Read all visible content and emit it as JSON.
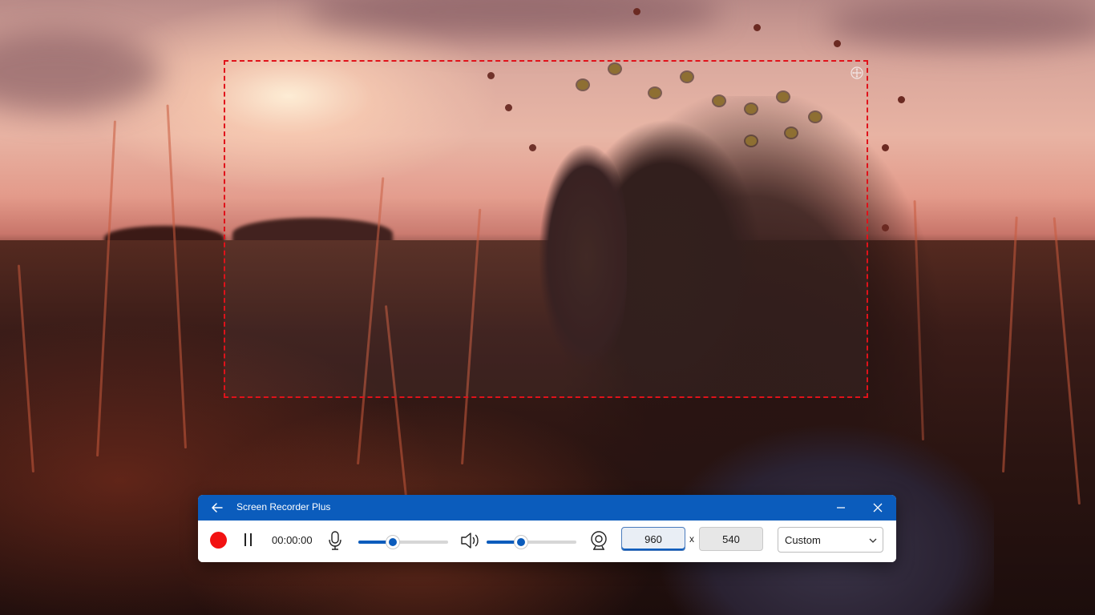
{
  "window": {
    "title": "Screen Recorder Plus",
    "back_icon": "arrow-left-icon",
    "minimize_icon": "minimize-icon",
    "close_icon": "close-icon"
  },
  "recorder": {
    "record_icon": "record-icon",
    "pause_icon": "pause-icon",
    "timer": "00:00:00",
    "microphone_icon": "microphone-icon",
    "mic_level": 0.38,
    "speaker_icon": "speaker-icon",
    "volume_level": 0.38,
    "webcam_icon": "webcam-icon",
    "width_value": "960",
    "dimension_separator": "x",
    "height_value": "540",
    "preset": "Custom",
    "preset_chevron_icon": "chevron-down-icon"
  },
  "capture_region": {
    "border_color": "#e0121a",
    "move_icon": "move-icon"
  },
  "colors": {
    "titlebar": "#0b5cbc",
    "record": "#f21212",
    "accent": "#0b5cbc"
  }
}
